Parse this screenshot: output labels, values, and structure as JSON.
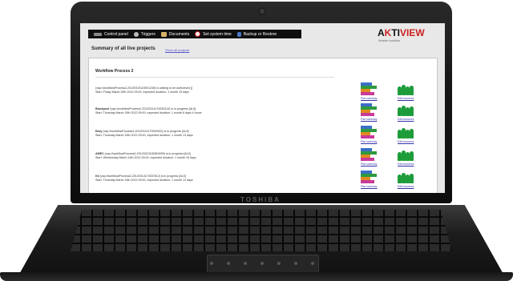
{
  "hardware": {
    "brand": "TOSHIBA"
  },
  "nav": {
    "items": [
      {
        "label": "Control panel",
        "icon": "panel-icon"
      },
      {
        "label": "Triggers",
        "icon": "gear-icon"
      },
      {
        "label": "Documents",
        "icon": "document-icon"
      },
      {
        "label": "Set system time",
        "icon": "clock-icon"
      },
      {
        "label": "Backup or Restore",
        "icon": "database-icon"
      }
    ]
  },
  "logo": {
    "a": "A",
    "k": "K",
    "rest": "TI",
    "red": "VIEW",
    "tagline": "Smarter workflow"
  },
  "summary": {
    "title": "Summary of all live projects",
    "show_all": "Show all projects"
  },
  "panel": {
    "title": "Workflow Process 2",
    "rows": [
      {
        "name": "",
        "line1": "(vap://workflowProcess2-20120319123001245) is waiting to be authorised []",
        "line2": "Start: Friday March 30th 2012 09:00, expected duration: 1 month 15 days",
        "plan_link": "Plan summary",
        "edit_link": "Edit resources"
      },
      {
        "name": "Blackpool",
        "line1": "(vap://workflowProcess2-20120314170020313) is in progress [AL5]",
        "line2": "Start: Thursday March 15th 2012 09:00, expected duration: 1 month 8 days 4 hours",
        "plan_link": "Plan summary",
        "edit_link": "Edit resources"
      },
      {
        "name": "Easy",
        "line1": "(vap://workflowProcess2-20120314170009915) is in progress [AL5]",
        "line2": "Start: Thursday March 15th 2012 09:00, expected duration: 1 month 13 days",
        "plan_link": "Plan summary",
        "edit_link": "Edit resources"
      },
      {
        "name": "AMEC",
        "line1": "(vap://workflowProcess2-20120313182804995) is in progress [AL5]",
        "line2": "Start: Wednesday March 14th 2012 09:00, expected duration: 1 month 15 days",
        "plan_link": "Plan summary",
        "edit_link": "Edit resources"
      },
      {
        "name": "KII",
        "line1": "(vap://workflowProcess2-20120314170337812) is in progress [AL5]",
        "line2": "Start: Thursday March 15th 2012 09:00, expected duration: 1 month 13 days",
        "plan_link": "Plan summary",
        "edit_link": "Edit resources"
      }
    ]
  }
}
